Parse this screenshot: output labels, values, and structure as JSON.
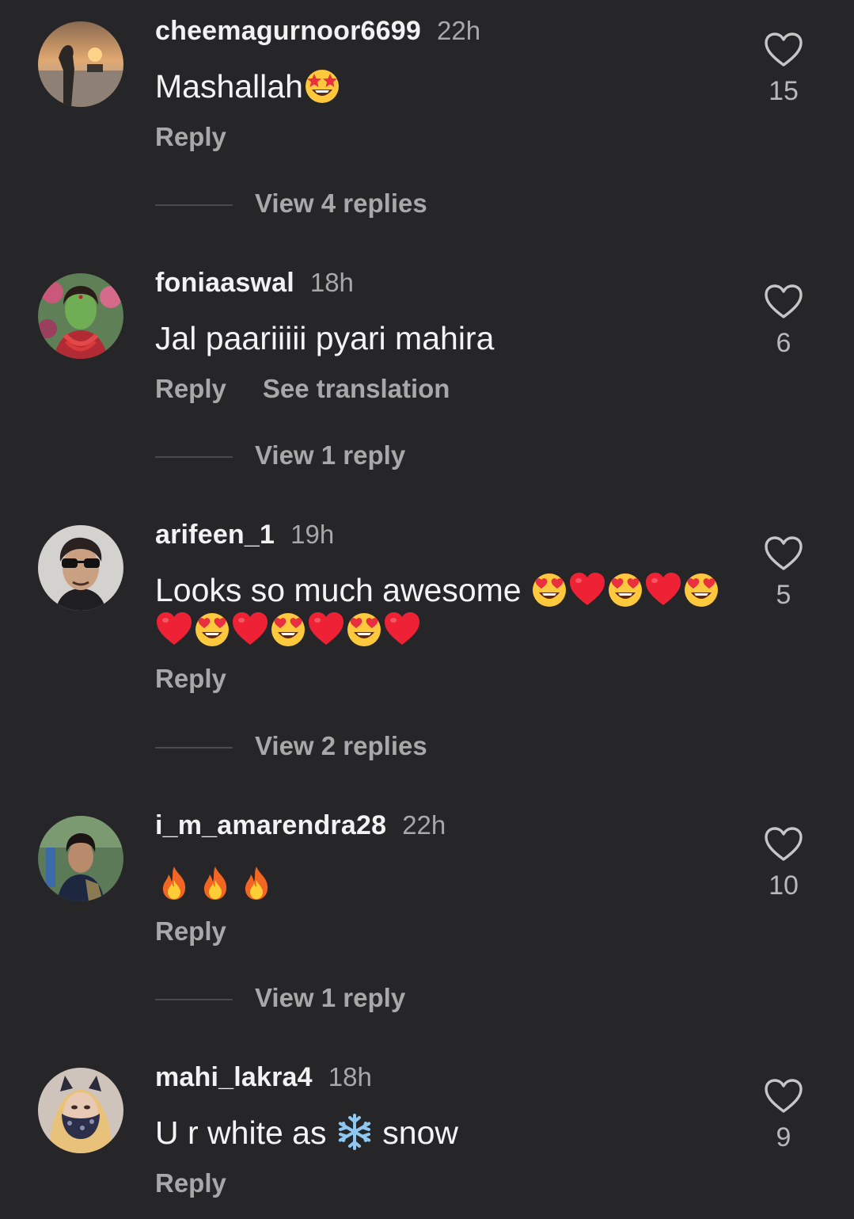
{
  "comments": [
    {
      "username": "cheemagurnoor6699",
      "time": "22h",
      "text": "Mashallah",
      "emojis": [
        "star-struck"
      ],
      "reply_label": "Reply",
      "view_replies": "View 4 replies",
      "likes": "15"
    },
    {
      "username": "foniaaswal",
      "time": "18h",
      "text": "Jal paariiiii pyari mahira",
      "emojis": [],
      "reply_label": "Reply",
      "translate_label": "See translation",
      "view_replies": "View 1 reply",
      "likes": "6"
    },
    {
      "username": "arifeen_1",
      "time": "19h",
      "text": "Looks so much awesome",
      "emojis": [
        "heart-eyes",
        "red-heart",
        "heart-eyes",
        "red-heart",
        "heart-eyes",
        "red-heart",
        "heart-eyes",
        "red-heart",
        "heart-eyes",
        "red-heart",
        "heart-eyes",
        "red-heart"
      ],
      "reply_label": "Reply",
      "view_replies": "View 2 replies",
      "likes": "5"
    },
    {
      "username": "i_m_amarendra28",
      "time": "22h",
      "text": "",
      "emojis": [
        "fire",
        "fire",
        "fire"
      ],
      "reply_label": "Reply",
      "view_replies": "View 1 reply",
      "likes": "10"
    },
    {
      "username": "mahi_lakra4",
      "time": "18h",
      "text_before": "U r white as",
      "text_after": "snow",
      "emojis": [
        "snowflake"
      ],
      "reply_label": "Reply",
      "likes": "9"
    }
  ],
  "colors": {
    "background": "#262628",
    "primary_text": "#f2f2f2",
    "secondary_text": "#a8a8a8",
    "divider": "#4a4a4c"
  }
}
